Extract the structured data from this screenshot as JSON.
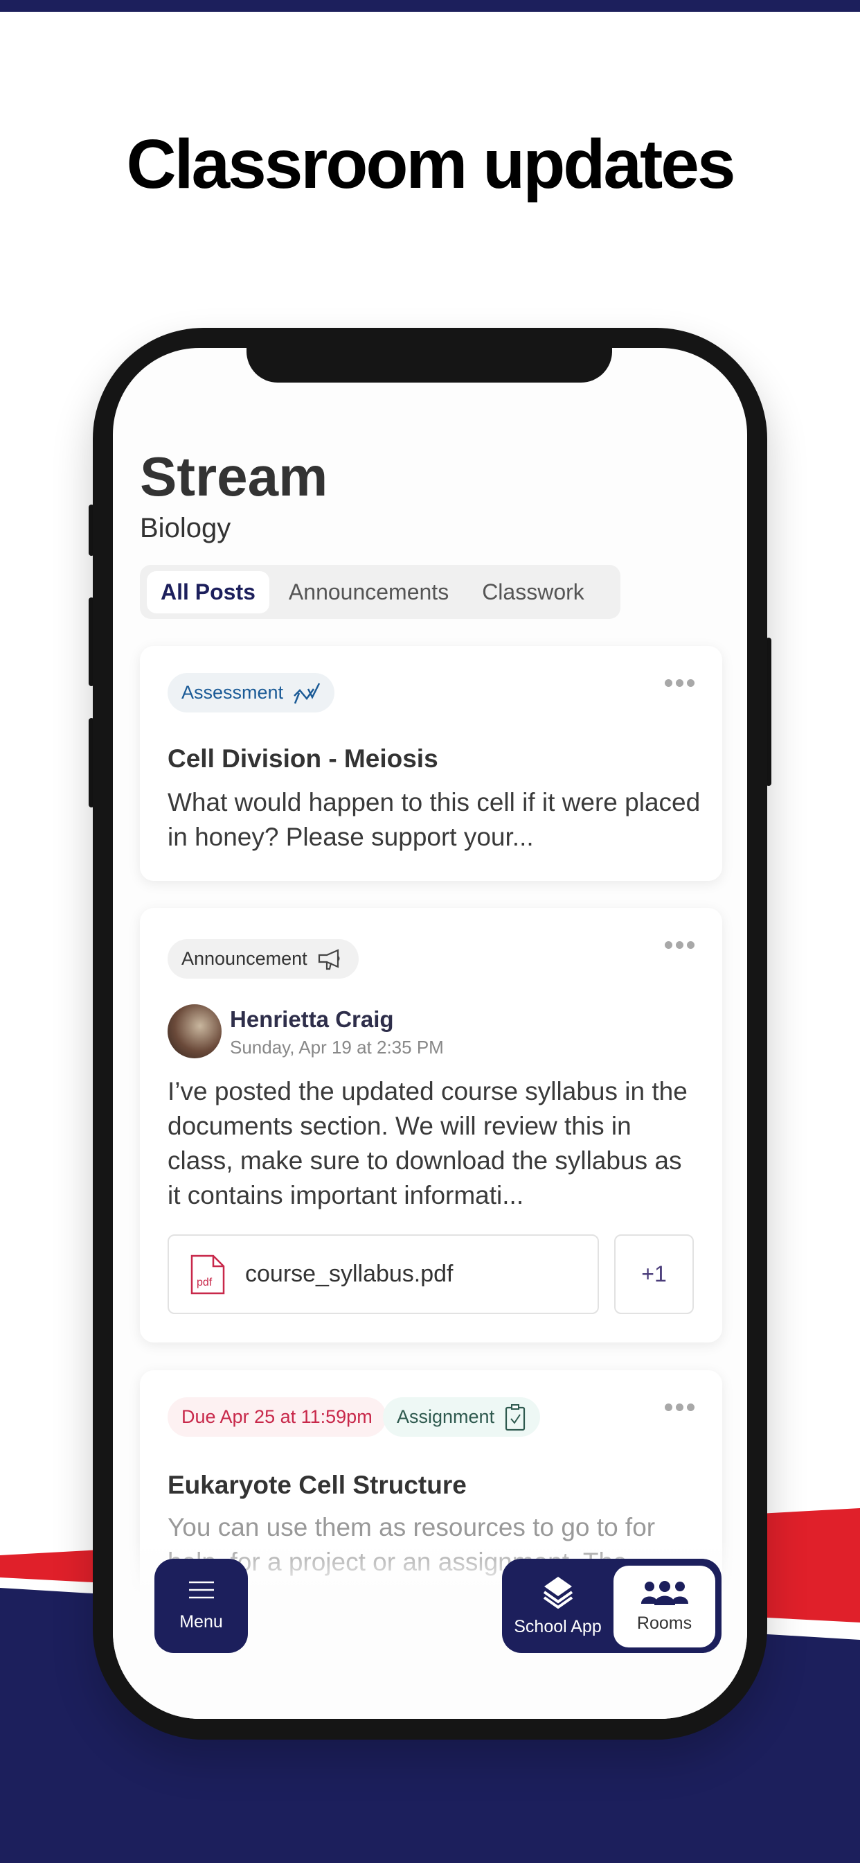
{
  "headline": "Classroom updates",
  "colors": {
    "navy": "#1c1f5c",
    "red": "#e0202a",
    "assessment": "#1a5a96",
    "due": "#c8284a",
    "assignment": "#2f5a4f"
  },
  "page": {
    "title": "Stream",
    "course": "Biology"
  },
  "tabs": [
    {
      "label": "All Posts",
      "active": true
    },
    {
      "label": "Announcements"
    },
    {
      "label": "Classwork"
    }
  ],
  "posts": [
    {
      "tag": "Assessment",
      "tag_icon": "chart-check-icon",
      "title": "Cell Division - Meiosis",
      "body": "What would happen to this cell if it were placed in honey? Please support your..."
    },
    {
      "tag": "Announcement",
      "tag_icon": "megaphone-icon",
      "author": "Henrietta Craig",
      "date": "Sunday, Apr 19 at 2:35 PM",
      "body": "I’ve posted the updated course syllabus in the documents section. We will review this in class, make sure to download the syllabus as it contains important informati...",
      "attachment": {
        "file": "course_syllabus.pdf",
        "icon_label": "pdf",
        "more": "+1"
      }
    },
    {
      "due": "Due Apr 25 at 11:59pm",
      "tag": "Assignment",
      "tag_icon": "clipboard-check-icon",
      "title": "Eukaryote Cell Structure",
      "body": "You can use them as resources to go to for help, for a project or an assignment. The"
    }
  ],
  "nav": {
    "menu": "Menu",
    "school_app": "School App",
    "rooms": "Rooms",
    "active": "Rooms"
  }
}
